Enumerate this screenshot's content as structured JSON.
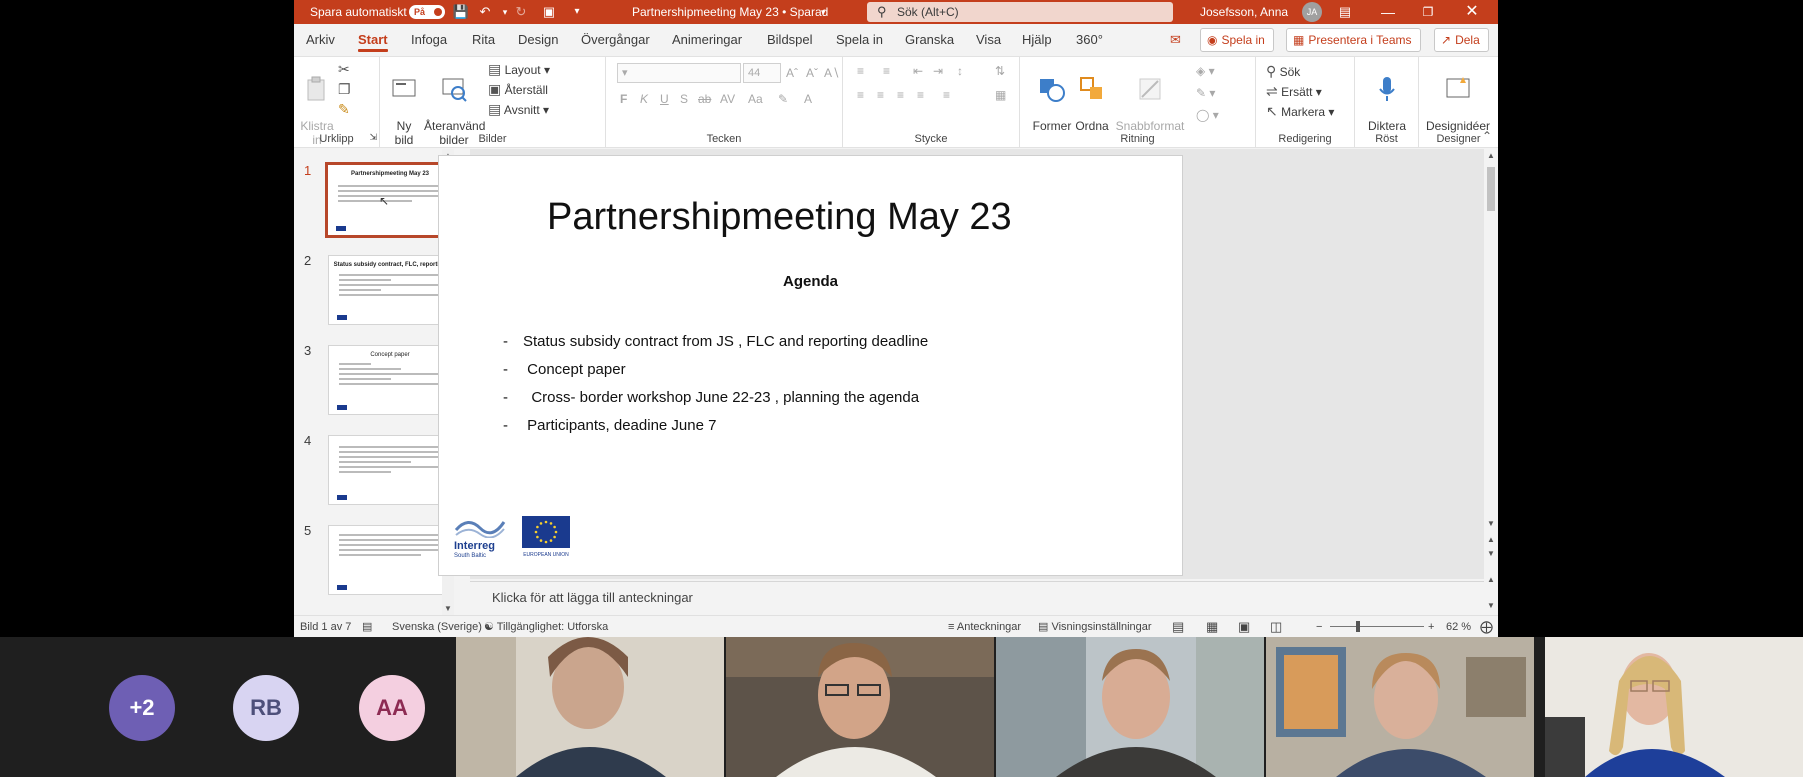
{
  "titlebar": {
    "autosave_label": "Spara automatiskt",
    "autosave_state": "På",
    "doc_title": "Partnershipmeeting May 23 • Sparad",
    "search_placeholder": "Sök (Alt+C)",
    "user_name": "Josefsson, Anna",
    "user_initials": "JA"
  },
  "menu": {
    "tabs": [
      "Arkiv",
      "Start",
      "Infoga",
      "Rita",
      "Design",
      "Övergångar",
      "Animeringar",
      "Bildspel",
      "Spela in",
      "Granska",
      "Visa",
      "Hjälp",
      "360°"
    ],
    "active_tab": "Start",
    "play_button": "Spela in",
    "present_teams": "Presentera i Teams",
    "share": "Dela"
  },
  "ribbon": {
    "urklipp": {
      "label": "Urklipp",
      "paste": "Klistra\nin"
    },
    "bilder": {
      "label": "Bilder",
      "new_slide": "Ny\nbild",
      "reuse": "Återanvänd\nbilder",
      "layout": "Layout",
      "reset": "Återställ",
      "section": "Avsnitt"
    },
    "tecken": {
      "label": "Tecken",
      "font_size": "44",
      "bold": "F",
      "italic": "K",
      "underline": "U",
      "strike": "S"
    },
    "stycke": {
      "label": "Stycke"
    },
    "ritning": {
      "label": "Ritning",
      "shapes": "Former",
      "arrange": "Ordna",
      "quick_styles": "Snabbformat"
    },
    "redigering": {
      "label": "Redigering",
      "find": "Sök",
      "replace": "Ersätt",
      "select": "Markera"
    },
    "rost": {
      "label": "Röst",
      "dictate": "Diktera"
    },
    "designer": {
      "label": "Designer",
      "ideas": "Designidéer"
    }
  },
  "thumbnails": [
    {
      "num": "1",
      "title": "Partnershipmeeting May 23"
    },
    {
      "num": "2",
      "title": "Status subsidy contract, FLC, reporting"
    },
    {
      "num": "3",
      "title": "Concept paper"
    },
    {
      "num": "4",
      "title": ""
    },
    {
      "num": "5",
      "title": ""
    }
  ],
  "slide": {
    "title": "Partnershipmeeting May 23",
    "subtitle": "Agenda",
    "bullets": [
      "Status subsidy contract from JS , FLC and reporting deadline",
      " Concept paper",
      "  Cross- border workshop June 22-23 , planning the agenda",
      " Participants, deadine June 7"
    ],
    "logo_interreg": "Interreg",
    "logo_interreg_sub": "South Baltic",
    "logo_eu": "EUROPEAN UNION"
  },
  "notes_placeholder": "Klicka för att lägga till anteckningar",
  "statusbar": {
    "slide_count": "Bild 1 av 7",
    "language": "Svenska (Sverige)",
    "accessibility": "Tillgänglighet: Utforska",
    "notes": "Anteckningar",
    "display_settings": "Visningsinställningar",
    "zoom": "62 %"
  },
  "participants": {
    "more": "+2",
    "initials": [
      "RB",
      "AA"
    ]
  },
  "colors": {
    "accent": "#c43e1c",
    "selected_thumb_border": "#b7472a",
    "circle_more": "#6e5fb4",
    "circle_rb": "#d8d4f2",
    "circle_aa": "#f4cfe0"
  }
}
